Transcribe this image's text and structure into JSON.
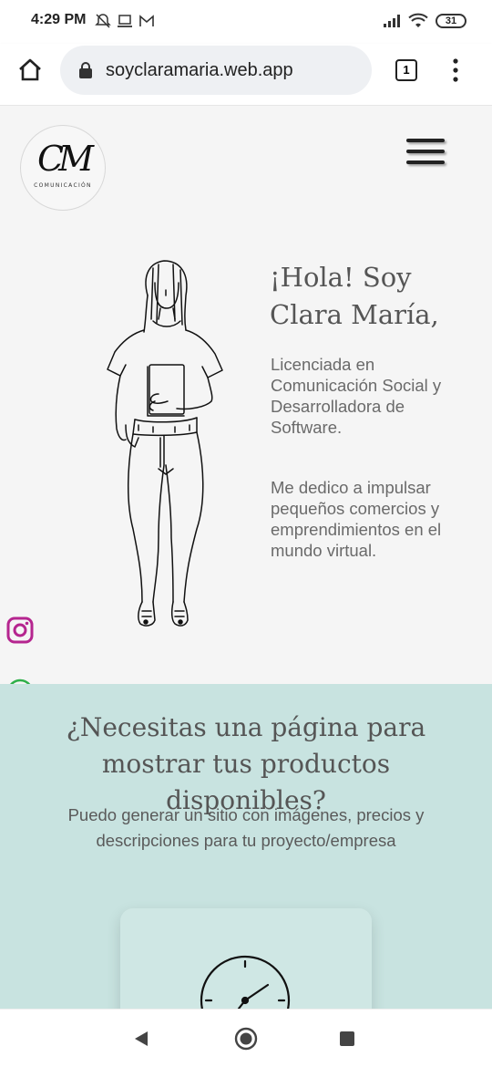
{
  "status_bar": {
    "time": "4:29 PM",
    "left_icons": [
      "notifications-off-icon",
      "laptop-icon",
      "gmail-icon"
    ],
    "right_icons": [
      "signal-icon",
      "wifi-icon"
    ],
    "battery": "31"
  },
  "browser": {
    "url": "soyclaramaria.web.app",
    "tab_count": "1"
  },
  "header": {
    "logo_mark": "CM",
    "logo_subtitle": "COMUNICACIÓN"
  },
  "hero": {
    "title": "¡Hola! Soy Clara María,",
    "paragraph_1": "Licenciada en Comunicación Social y Desarrolladora de Software.",
    "paragraph_2": "Me dedico a impulsar pequeños comercios y emprendimientos en el mundo virtual."
  },
  "social": [
    "instagram-icon",
    "whatsapp-icon"
  ],
  "section_products": {
    "title": "¿Necesitas una página para mostrar tus productos disponibles?",
    "text": "Puedo generar un sitio con imágenes, precios y descripciones para tu proyecto/empresa"
  },
  "colors": {
    "mint": "#c8e3e0",
    "page_bg": "#f5f5f5",
    "instagram": "#b5258f",
    "whatsapp": "#2fb04a"
  }
}
